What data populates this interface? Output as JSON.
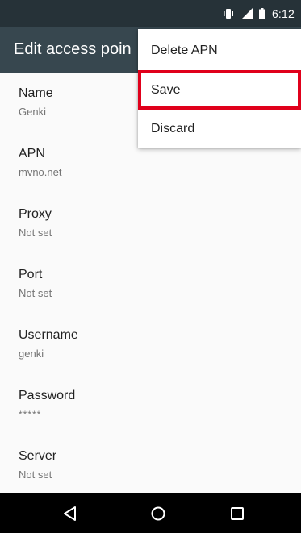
{
  "status_bar": {
    "time": "6:12",
    "icons": [
      "vibrate-icon",
      "signal-icon",
      "battery-icon"
    ]
  },
  "toolbar": {
    "title": "Edit access poin"
  },
  "preferences": [
    {
      "title": "Name",
      "summary": "Genki"
    },
    {
      "title": "APN",
      "summary": "mvno.net"
    },
    {
      "title": "Proxy",
      "summary": "Not set"
    },
    {
      "title": "Port",
      "summary": "Not set"
    },
    {
      "title": "Username",
      "summary": "genki"
    },
    {
      "title": "Password",
      "summary": "*****"
    },
    {
      "title": "Server",
      "summary": "Not set"
    }
  ],
  "overflow_menu": {
    "items": [
      {
        "label": "Delete APN"
      },
      {
        "label": "Save"
      },
      {
        "label": "Discard"
      }
    ],
    "highlight_color": "#e0001b"
  },
  "nav_bar": {
    "icons": [
      "back-icon",
      "home-icon",
      "recents-icon"
    ]
  },
  "colors": {
    "status_bar": "#263238",
    "toolbar": "#37474f",
    "background": "#fafafa"
  }
}
